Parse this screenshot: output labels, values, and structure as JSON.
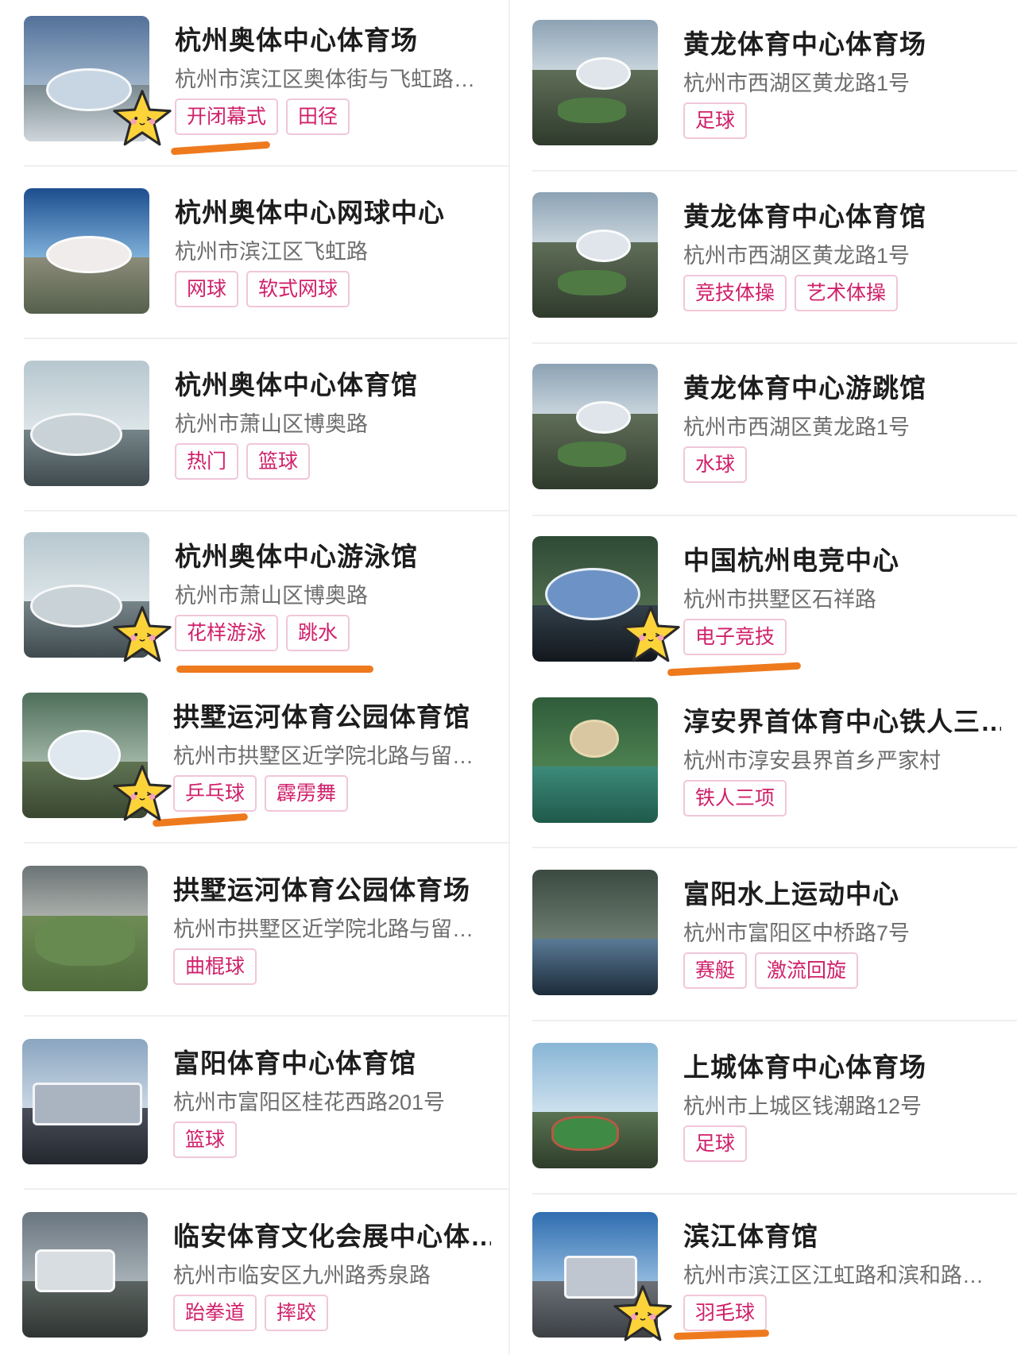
{
  "left_venues": [
    {
      "name": "杭州奥体中心体育场",
      "address": "杭州市滨江区奥体街与飞虹路…",
      "tags": [
        "开闭幕式",
        "田径"
      ]
    },
    {
      "name": "杭州奥体中心网球中心",
      "address": "杭州市滨江区飞虹路",
      "tags": [
        "网球",
        "软式网球"
      ]
    },
    {
      "name": "杭州奥体中心体育馆",
      "address": "杭州市萧山区博奥路",
      "tags": [
        "热门",
        "篮球"
      ]
    },
    {
      "name": "杭州奥体中心游泳馆",
      "address": "杭州市萧山区博奥路",
      "tags": [
        "花样游泳",
        "跳水"
      ]
    },
    {
      "name": "拱墅运河体育公园体育馆",
      "address": "杭州市拱墅区近学院北路与留…",
      "tags": [
        "乒乓球",
        "霹雳舞"
      ]
    },
    {
      "name": "拱墅运河体育公园体育场",
      "address": "杭州市拱墅区近学院北路与留…",
      "tags": [
        "曲棍球"
      ]
    },
    {
      "name": "富阳体育中心体育馆",
      "address": "杭州市富阳区桂花西路201号",
      "tags": [
        "篮球"
      ]
    },
    {
      "name": "临安体育文化会展中心体…",
      "address": "杭州市临安区九州路秀泉路",
      "tags": [
        "跆拳道",
        "摔跤"
      ]
    }
  ],
  "right_venues": [
    {
      "name": "黄龙体育中心体育场",
      "address": "杭州市西湖区黄龙路1号",
      "tags": [
        "足球"
      ]
    },
    {
      "name": "黄龙体育中心体育馆",
      "address": "杭州市西湖区黄龙路1号",
      "tags": [
        "竞技体操",
        "艺术体操"
      ]
    },
    {
      "name": "黄龙体育中心游跳馆",
      "address": "杭州市西湖区黄龙路1号",
      "tags": [
        "水球"
      ]
    },
    {
      "name": "中国杭州电竞中心",
      "address": "杭州市拱墅区石祥路",
      "tags": [
        "电子竞技"
      ]
    },
    {
      "name": "淳安界首体育中心铁人三…",
      "address": "杭州市淳安县界首乡严家村",
      "tags": [
        "铁人三项"
      ]
    },
    {
      "name": "富阳水上运动中心",
      "address": "杭州市富阳区中桥路7号",
      "tags": [
        "赛艇",
        "激流回旋"
      ]
    },
    {
      "name": "上城体育中心体育场",
      "address": "杭州市上城区钱潮路12号",
      "tags": [
        "足球"
      ]
    },
    {
      "name": "滨江体育馆",
      "address": "杭州市滨江区江虹路和滨和路…",
      "tags": [
        "羽毛球"
      ]
    }
  ],
  "colors": {
    "tag_text": "#d0206a",
    "tag_border": "#f0c7da",
    "highlight_underline": "#ee7a1e",
    "star_sticker": "#fdd33a"
  },
  "icons": {
    "sticker": "smiling-star-icon"
  }
}
